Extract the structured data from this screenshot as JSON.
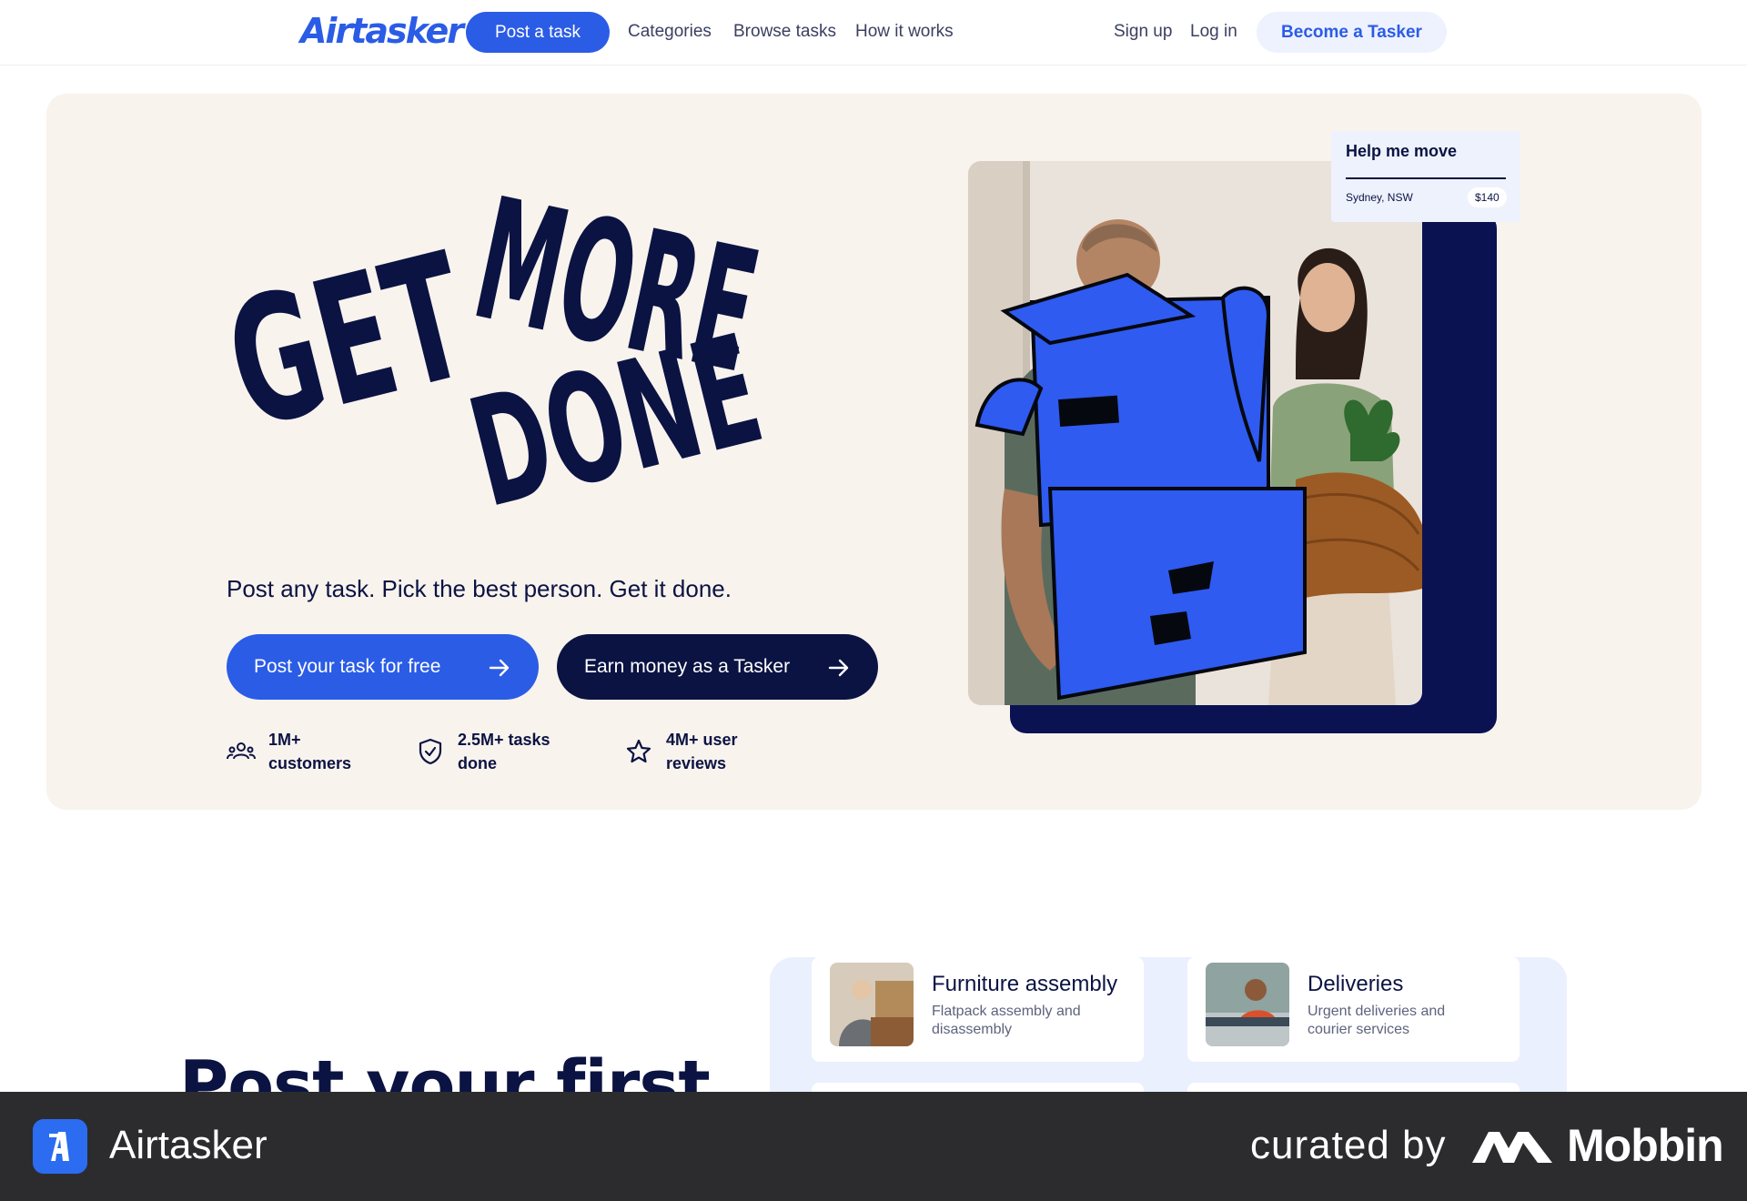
{
  "header": {
    "logo": "Airtasker",
    "post_task": "Post a task",
    "nav": [
      "Categories",
      "Browse tasks",
      "How it works"
    ],
    "sign_up": "Sign up",
    "log_in": "Log in",
    "become_tasker": "Become a Tasker"
  },
  "hero": {
    "headline_lines": [
      "GET",
      "MORE",
      "DONE"
    ],
    "subtitle": "Post any task. Pick the best person. Get it done.",
    "cta_primary": "Post your task for free",
    "cta_secondary": "Earn money as a Tasker",
    "stats": [
      {
        "line1": "1M+",
        "line2": "customers",
        "icon": "people-icon"
      },
      {
        "line1": "2.5M+ tasks",
        "line2": "done",
        "icon": "shield-check-icon"
      },
      {
        "line1": "4M+ user",
        "line2": "reviews",
        "icon": "star-icon"
      }
    ],
    "task_card": {
      "title": "Help me move",
      "location": "Sydney, NSW",
      "price": "$140"
    }
  },
  "section": {
    "heading": "Post your first",
    "categories": [
      {
        "title": "Furniture assembly",
        "desc": "Flatpack assembly and disassembly"
      },
      {
        "title": "Deliveries",
        "desc": "Urgent deliveries and courier services"
      }
    ]
  },
  "footer": {
    "app_name": "Airtasker",
    "curated_by": "curated by",
    "brand": "Mobbin"
  },
  "colors": {
    "brand_blue": "#2b5ce6",
    "navy": "#0b1343",
    "hero_bg": "#f8f3ed",
    "footer_bg": "#2c2c2e"
  }
}
